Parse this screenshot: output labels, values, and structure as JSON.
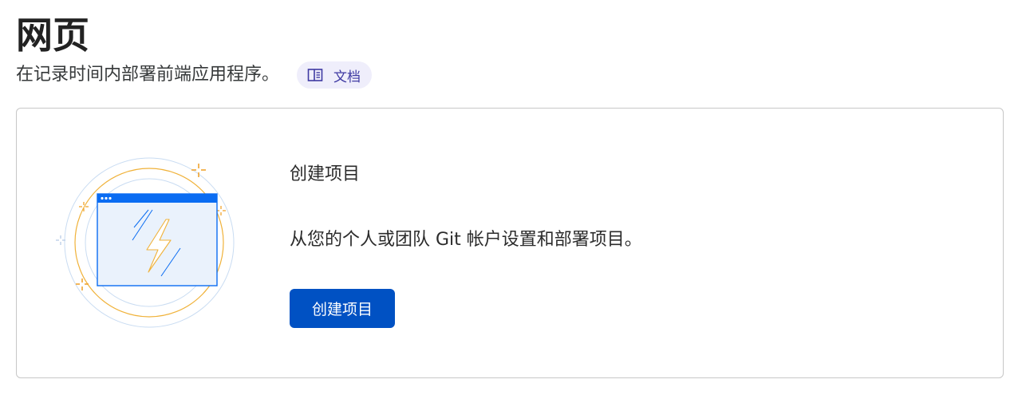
{
  "header": {
    "title": "网页",
    "subtitle": "在记录时间内部署前端应用程序。",
    "docs_label": "文档",
    "docs_icon": "book-open-icon"
  },
  "card": {
    "heading": "创建项目",
    "description": "从您的个人或团队 Git 帐户设置和部署项目。",
    "button_label": "创建项目",
    "illustration_icon": "browser-lightning-illustration"
  },
  "colors": {
    "primary_button": "#0051c3",
    "docs_pill_bg": "#efeefb",
    "docs_pill_text": "#3f3aa3",
    "illustration_blue": "#0a6cf2",
    "illustration_orange": "#f0a330"
  }
}
